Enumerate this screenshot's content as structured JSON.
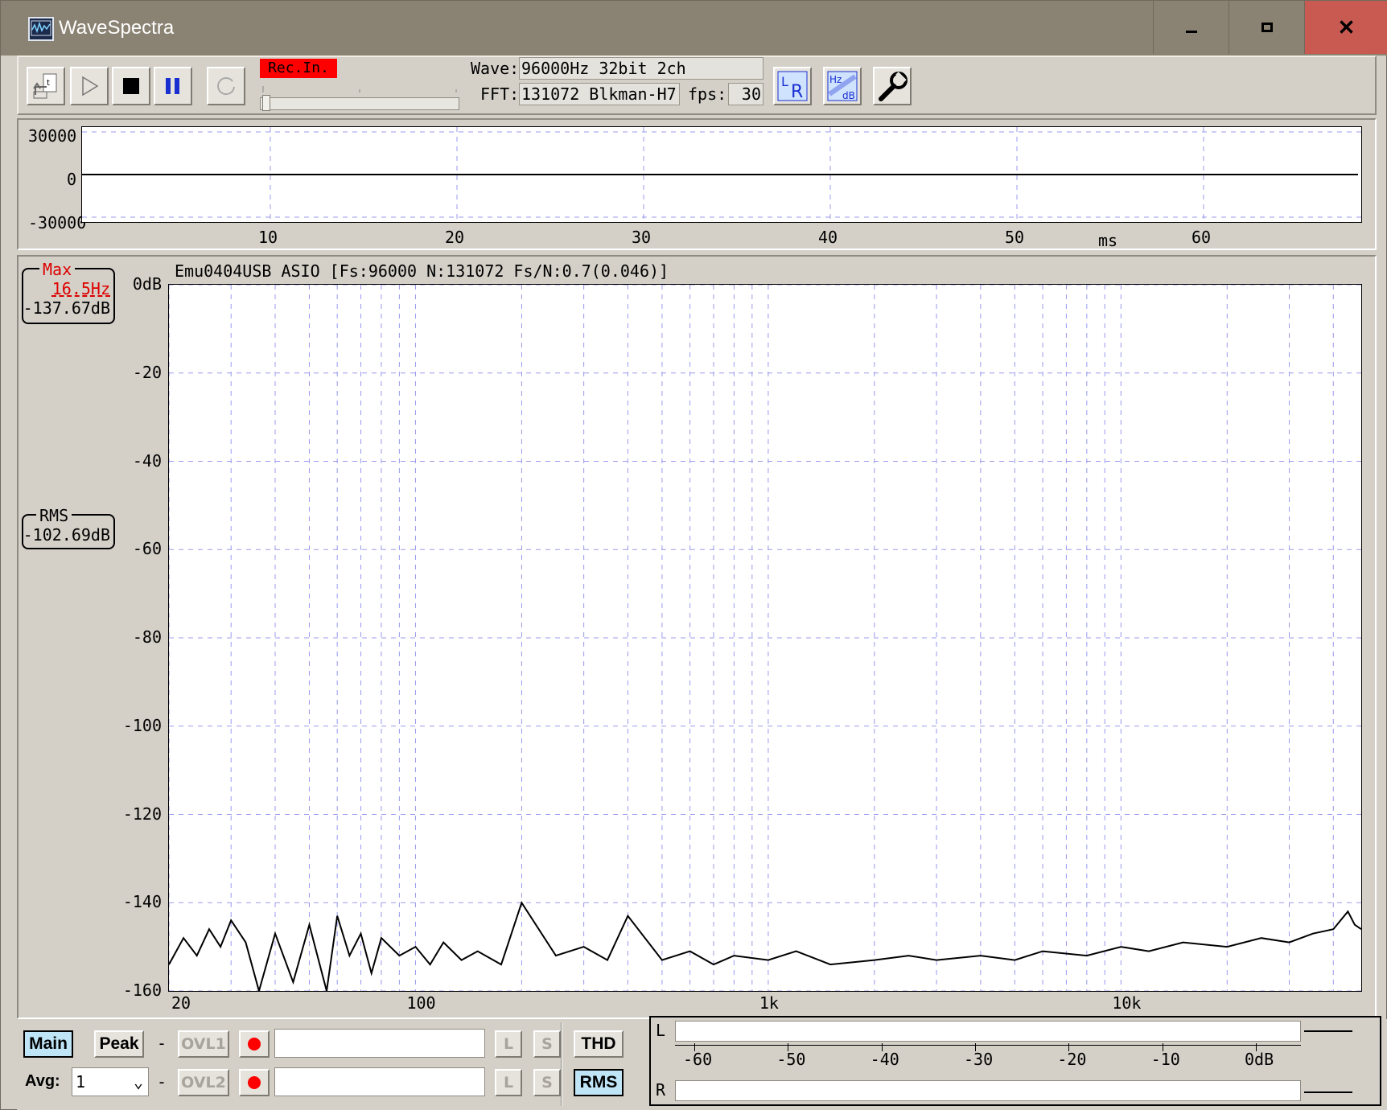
{
  "window": {
    "title": "WaveSpectra",
    "minimize_icon": "minimize-icon",
    "maximize_icon": "maximize-icon",
    "close_icon": "close-icon"
  },
  "toolbar": {
    "buttons": [
      "export-icon",
      "play-icon",
      "stop-icon",
      "pause-icon",
      "loop-icon"
    ],
    "rec_label": "Rec.In.",
    "wave_label": "Wave:",
    "wave_value": "96000Hz 32bit 2ch",
    "fft_label": "FFT:",
    "fft_value": "131072 Blkman-H7",
    "fps_label": "fps:",
    "fps_value": "30",
    "right_buttons": [
      "lr-channel-icon",
      "hz-db-icon",
      "settings-wrench-icon"
    ],
    "lr_text": [
      "L",
      "R"
    ],
    "hzdb_text": [
      "Hz",
      "dB"
    ]
  },
  "wave_panel": {
    "y_ticks": [
      "30000",
      "0",
      "-30000"
    ],
    "x_ticks": [
      "10",
      "20",
      "30",
      "40",
      "50",
      "60"
    ],
    "x_unit": "ms"
  },
  "spectrum_panel": {
    "header": "Emu0404USB ASIO  [Fs:96000 N:131072 Fs/N:0.7(0.046)]",
    "max_label": "Max",
    "max_freq": "16.5Hz",
    "max_db": "-137.67dB",
    "rms_label": "RMS",
    "rms_db": "-102.69dB",
    "y_ticks": [
      "0dB",
      "-20",
      "-40",
      "-60",
      "-80",
      "-100",
      "-120",
      "-140",
      "-160"
    ],
    "x_ticks": [
      "20",
      "100",
      "1k",
      "10k"
    ]
  },
  "chart_data": {
    "type": "line",
    "x_scale": "log",
    "xlim": [
      20,
      48000
    ],
    "ylim": [
      -160,
      0
    ],
    "grid": true,
    "x_tick_labels": [
      "20",
      "100",
      "1k",
      "10k"
    ],
    "y_tick_labels": [
      "0dB",
      "-20",
      "-40",
      "-60",
      "-80",
      "-100",
      "-120",
      "-140",
      "-160"
    ],
    "series": [
      {
        "x": [
          20,
          22,
          24,
          26,
          28,
          30,
          33,
          36,
          40,
          45,
          50,
          56,
          60,
          65,
          70,
          75,
          80,
          90,
          100,
          110,
          120,
          135,
          150,
          175,
          200,
          250,
          300,
          350,
          400,
          500,
          600,
          700,
          800,
          1000,
          1200,
          1500,
          2000,
          2500,
          3000,
          4000,
          5000,
          6000,
          8000,
          10000,
          12000,
          15000,
          20000,
          25000,
          30000,
          35000,
          40000,
          44000,
          46000,
          48000
        ],
        "y": [
          -154,
          -148,
          -152,
          -146,
          -150,
          -144,
          -149,
          -160,
          -147,
          -158,
          -145,
          -160,
          -143,
          -152,
          -147,
          -156,
          -148,
          -152,
          -150,
          -154,
          -149,
          -153,
          -151,
          -154,
          -140,
          -152,
          -150,
          -153,
          -143,
          -153,
          -151,
          -154,
          -152,
          -153,
          -151,
          -154,
          -153,
          -152,
          -153,
          -152,
          -153,
          -151,
          -152,
          -150,
          -151,
          -149,
          -150,
          -148,
          -149,
          -147,
          -146,
          -142,
          -145,
          -146
        ]
      }
    ]
  },
  "bottom": {
    "main_label": "Main",
    "peak_label": "Peak",
    "dash": "-",
    "ovl1_label": "OVL1",
    "ovl2_label": "OVL2",
    "avg_label": "Avg:",
    "avg_value": "1",
    "l_label": "L",
    "s_label": "S",
    "thd_label": "THD",
    "rms_label": "RMS"
  },
  "meter": {
    "l_label": "L",
    "r_label": "R",
    "ticks": [
      "-60",
      "-50",
      "-40",
      "-30",
      "-20",
      "-10",
      "0dB"
    ]
  }
}
